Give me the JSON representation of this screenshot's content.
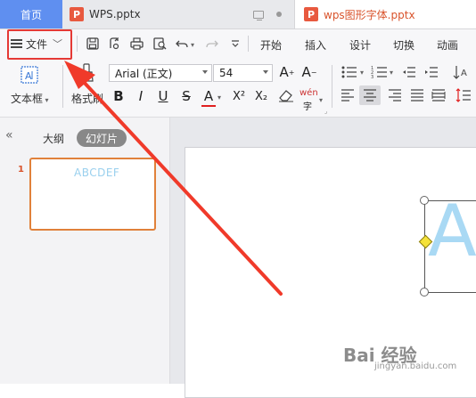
{
  "tabs": {
    "home": "首页",
    "doc1": "WPS.pptx",
    "doc2": "wps图形字体.pptx"
  },
  "menu": {
    "file_label": "文件"
  },
  "ribbon_tabs": [
    "开始",
    "插入",
    "设计",
    "切换",
    "动画"
  ],
  "toolbar": {
    "textbox_label": "文本框",
    "format_painter_label": "格式刷",
    "font_name": "Arial (正文)",
    "font_size": "54",
    "bold": "B",
    "italic": "I",
    "underline": "U",
    "strike": "S",
    "color_a": "A",
    "superscript": "X²",
    "subscript": "X₂",
    "wen": "wén"
  },
  "left_panel": {
    "outline_tab": "大纲",
    "slides_tab": "幻灯片",
    "slide_number": "1",
    "thumb_text": "ABCDEF"
  },
  "slide": {
    "big_letter": "A"
  },
  "watermark": {
    "brand": "Bai 经验",
    "url": "jingyan.baidu.com"
  },
  "colors": {
    "accent": "#5f8ff0",
    "highlight_box": "#e53935",
    "arrow": "#f03a2a",
    "thumb_border": "#e0813a",
    "text_fill": "#a9d9f4"
  }
}
